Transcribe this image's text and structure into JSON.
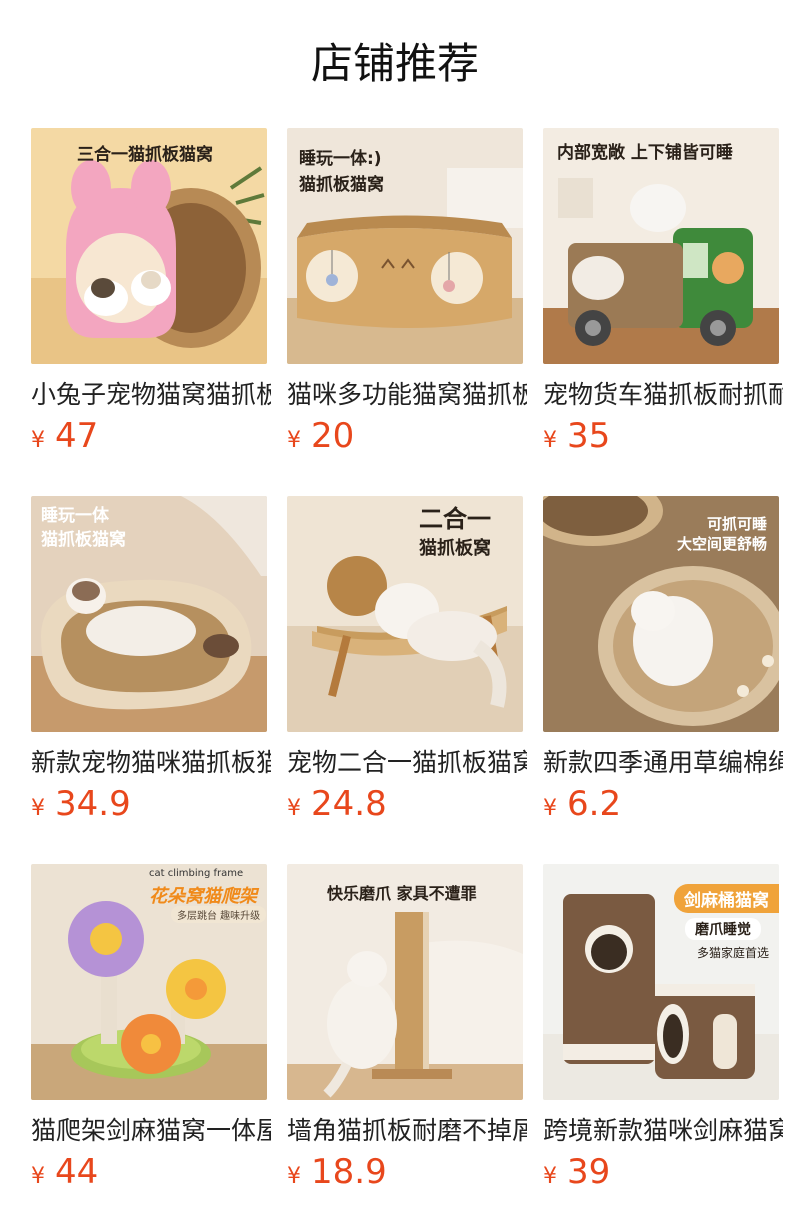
{
  "header": {
    "title": "店铺推荐"
  },
  "currency_symbol": "¥",
  "products": [
    {
      "name": "小兔子宠物猫窝猫抓板",
      "price": "47",
      "caption": [
        "三合一猫抓板猫窝"
      ]
    },
    {
      "name": "猫咪多功能猫窝猫抓板",
      "price": "20",
      "caption": [
        "睡玩一体:)",
        "猫抓板猫窝"
      ]
    },
    {
      "name": "宠物货车猫抓板耐抓耐",
      "price": "35",
      "caption": [
        "内部宽敞 上下铺皆可睡"
      ]
    },
    {
      "name": "新款宠物猫咪猫抓板猫",
      "price": "34.9",
      "caption": [
        "睡玩一体",
        "猫抓板猫窝"
      ]
    },
    {
      "name": "宠物二合一猫抓板猫窝",
      "price": "24.8",
      "caption": [
        "二合一",
        "猫抓板窝"
      ]
    },
    {
      "name": "新款四季通用草编棉绳",
      "price": "6.2",
      "caption": [
        "可抓可睡",
        "大空间更舒畅"
      ]
    },
    {
      "name": "猫爬架剑麻猫窝一体屋",
      "price": "44",
      "caption": [
        "cat climbing frame",
        "花朵窝猫爬架",
        "多层跳台 趣味升级"
      ]
    },
    {
      "name": "墙角猫抓板耐磨不掉屑",
      "price": "18.9",
      "caption": [
        "快乐磨爪 家具不遭罪"
      ]
    },
    {
      "name": "跨境新款猫咪剑麻猫窝",
      "price": "39",
      "caption": [
        "剑麻桶猫窝",
        "磨爪睡觉",
        "多猫家庭首选"
      ]
    }
  ]
}
